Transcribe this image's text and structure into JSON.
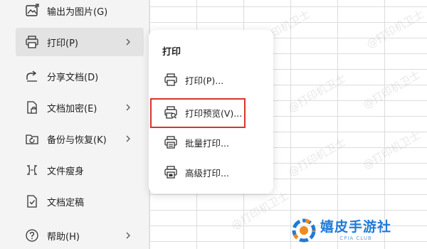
{
  "menu": {
    "items": [
      {
        "label": "输出为图片(G)",
        "icon": "image-export-icon",
        "submenu": false
      },
      {
        "label": "打印(P)",
        "icon": "printer-icon",
        "submenu": true,
        "active": true
      },
      {
        "label": "分享文档(D)",
        "icon": "share-icon",
        "submenu": false
      },
      {
        "label": "文档加密(E)",
        "icon": "document-lock-icon",
        "submenu": true
      },
      {
        "label": "备份与恢复(K)",
        "icon": "backup-icon",
        "submenu": true
      },
      {
        "label": "文件瘦身",
        "icon": "file-slim-icon",
        "submenu": false
      },
      {
        "label": "文档定稿",
        "icon": "document-finalize-icon",
        "submenu": false
      },
      {
        "label": "帮助(H)",
        "icon": "help-icon",
        "submenu": true
      }
    ]
  },
  "submenu": {
    "title": "打印",
    "items": [
      {
        "label": "打印(P)...",
        "icon": "printer-icon"
      },
      {
        "label": "打印预览(V)...",
        "icon": "print-preview-icon",
        "highlighted": true
      },
      {
        "label": "批量打印...",
        "icon": "batch-print-icon"
      },
      {
        "label": "高级打印...",
        "icon": "advanced-print-icon"
      }
    ]
  },
  "watermark": "@打印机卫士",
  "brand": {
    "name": "嬉皮手游社",
    "sub": "CPIA CLUB"
  },
  "colors": {
    "highlight": "#d9342b",
    "brand": "#1f7bd8",
    "menu_bg": "#f4f4f4"
  }
}
